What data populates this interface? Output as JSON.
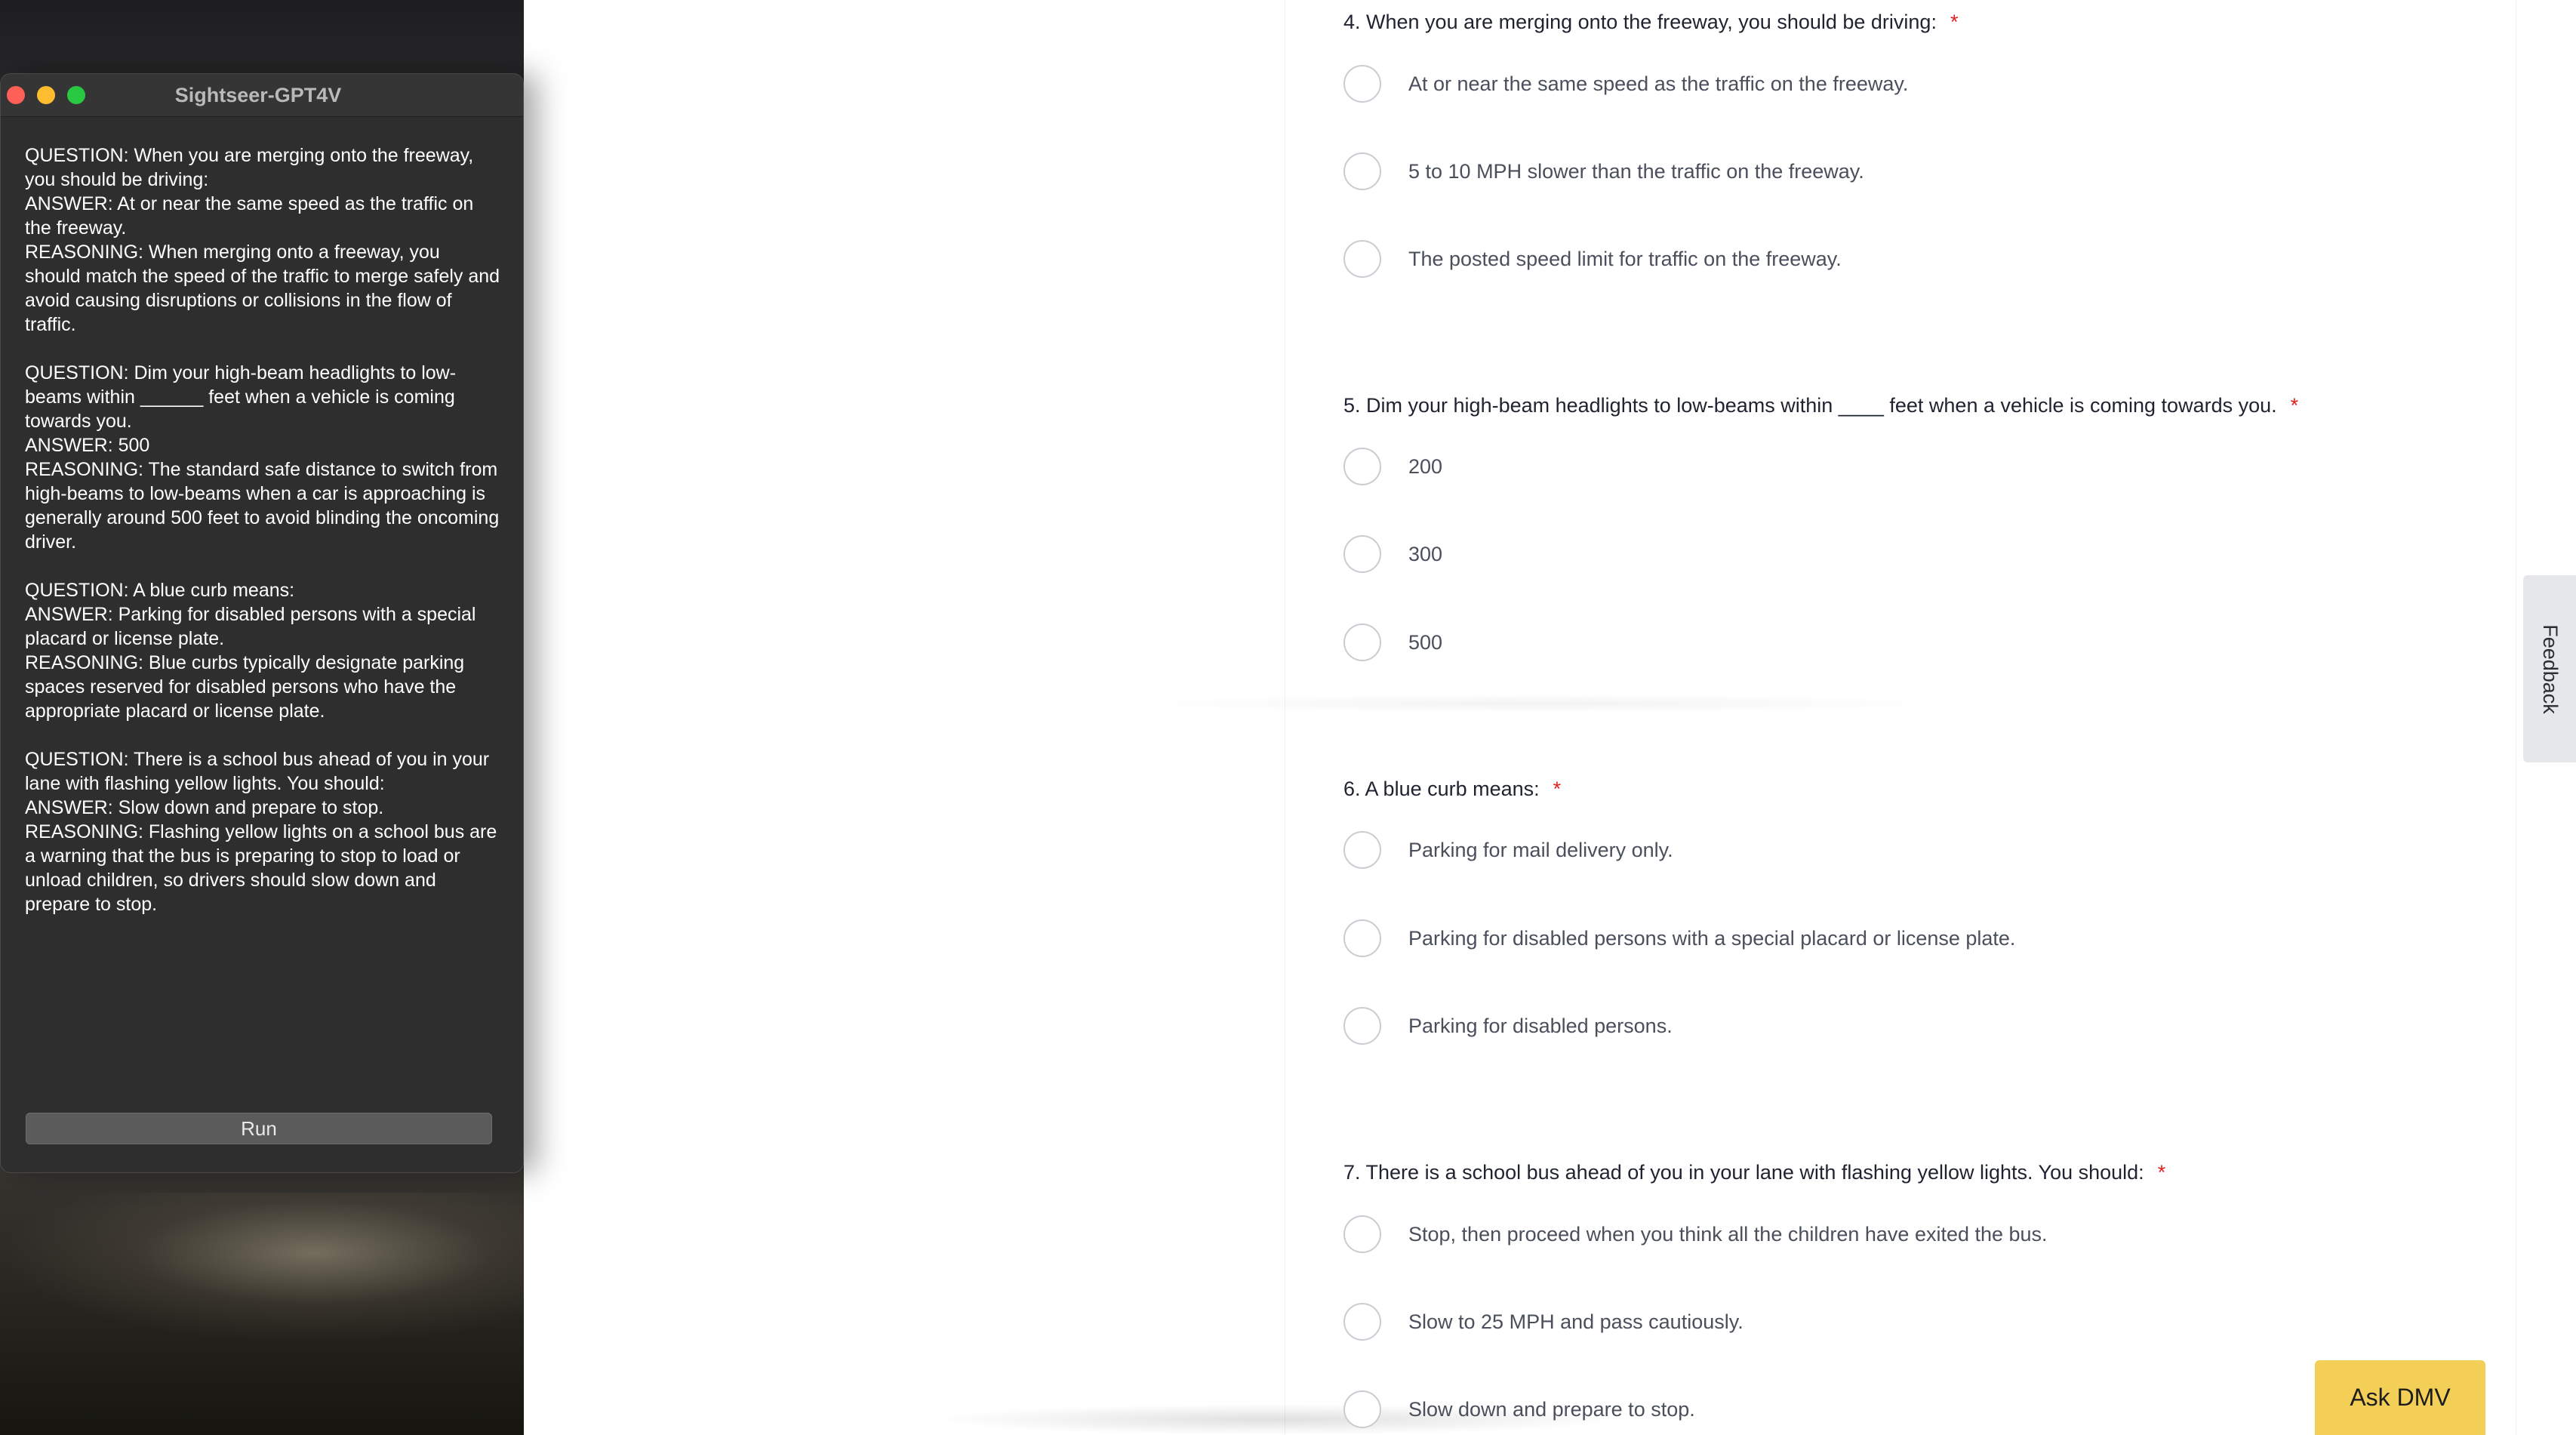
{
  "window": {
    "title": "Sightseer-GPT4V",
    "output_text": "QUESTION: When you are merging onto the freeway, you should be driving:\nANSWER: At or near the same speed as the traffic on the freeway.\nREASONING: When merging onto a freeway, you should match the speed of the traffic to merge safely and avoid causing disruptions or collisions in the flow of traffic.\n\nQUESTION: Dim your high-beam headlights to low-beams within ______ feet when a vehicle is coming towards you.\nANSWER: 500\nREASONING: The standard safe distance to switch from high-beams to low-beams when a car is approaching is generally around 500 feet to avoid blinding the oncoming driver.\n\nQUESTION: A blue curb means:\nANSWER: Parking for disabled persons with a special placard or license plate.\nREASONING: Blue curbs typically designate parking spaces reserved for disabled persons who have the appropriate placard or license plate.\n\nQUESTION: There is a school bus ahead of you in your lane with flashing yellow lights. You should:\nANSWER: Slow down and prepare to stop.\nREASONING: Flashing yellow lights on a school bus are a warning that the bus is preparing to stop to load or unload children, so drivers should slow down and prepare to stop.",
    "run_label": "Run"
  },
  "quiz": {
    "required_mark": "*",
    "questions": [
      {
        "title": "4. When you are merging onto the freeway, you should be driving:",
        "options": [
          "At or near the same speed as the traffic on the freeway.",
          "5 to 10 MPH slower than the traffic on the freeway.",
          "The posted speed limit for traffic on the freeway."
        ]
      },
      {
        "title": "5. Dim your high-beam headlights to low-beams within ____ feet when a vehicle is coming towards you.",
        "options": [
          "200",
          "300",
          "500"
        ]
      },
      {
        "title": "6. A blue curb means:",
        "options": [
          "Parking for mail delivery only.",
          "Parking for disabled persons with a special placard or license plate.",
          "Parking for disabled persons."
        ]
      },
      {
        "title": "7. There is a school bus ahead of you in your lane with flashing yellow lights. You should:",
        "options": [
          "Stop, then proceed when you think all the children have exited the bus.",
          "Slow to 25 MPH and pass cautiously.",
          "Slow down and prepare to stop."
        ]
      }
    ]
  },
  "feedback_label": "Feedback",
  "ask_dmv_label": "Ask DMV",
  "colors": {
    "required": "#e02020",
    "ask_dmv_bg": "#f3cf58",
    "window_bg": "#2e2e2e"
  }
}
